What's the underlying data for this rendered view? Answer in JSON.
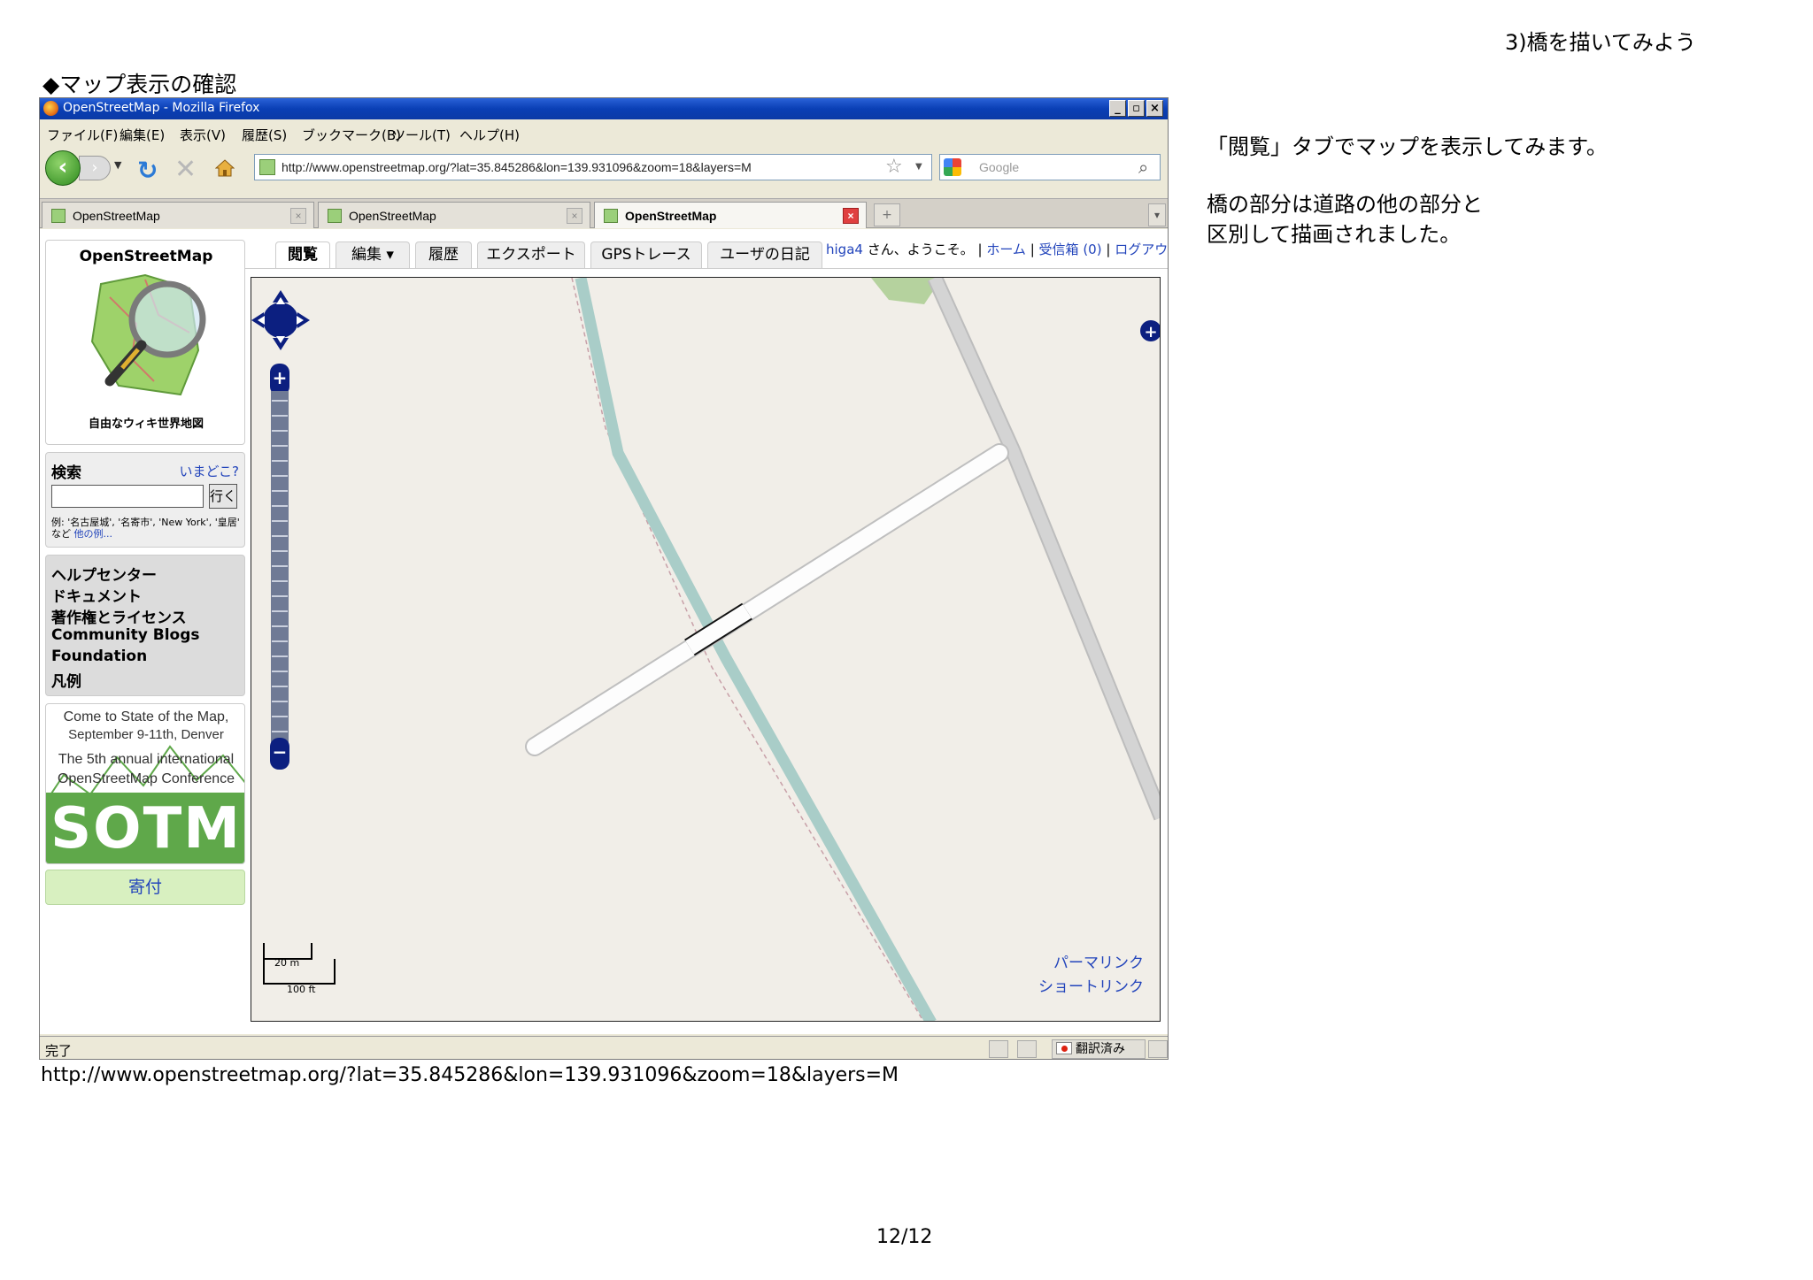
{
  "page": {
    "header": "3)橋を描いてみよう",
    "section_title": "◆マップ表示の確認",
    "description_1": "「閲覧」タブでマップを表示してみます。",
    "description_2_line1": "橋の部分は道路の他の部分と",
    "description_2_line2": "区別して描画されました。",
    "url_caption": "http://www.openstreetmap.org/?lat=35.845286&lon=139.931096&zoom=18&layers=M",
    "page_number": "12/12"
  },
  "window": {
    "title": "OpenStreetMap - Mozilla Firefox",
    "buttons": {
      "minimize": "_",
      "maximize": "▫",
      "close": "×"
    }
  },
  "menu": {
    "items": [
      "ファイル(F)",
      "編集(E)",
      "表示(V)",
      "履歴(S)",
      "ブックマーク(B)",
      "ツール(T)",
      "ヘルプ(H)"
    ]
  },
  "navbar": {
    "address": "http://www.openstreetmap.org/?lat=35.845286&lon=139.931096&zoom=18&layers=M",
    "search_placeholder": "Google",
    "icons": [
      "back-icon",
      "forward-icon",
      "reload-icon",
      "stop-icon",
      "home-icon",
      "star-icon",
      "search-icon"
    ]
  },
  "browser_tabs": [
    {
      "label": "OpenStreetMap",
      "active": false
    },
    {
      "label": "OpenStreetMap",
      "active": false
    },
    {
      "label": "OpenStreetMap",
      "active": true
    }
  ],
  "sidebar": {
    "logo_title": "OpenStreetMap",
    "logo_tagline": "自由なウィキ世界地図",
    "search": {
      "label": "検索",
      "where_link": "いまどこ?",
      "input_value": "",
      "go_button": "行く",
      "examples": "例: '名古屋城', '名寄市', 'New York', '皇居' など",
      "more_link": "他の例..."
    },
    "help_links": [
      "ヘルプセンター",
      "ドキュメント",
      "著作権とライセンス",
      "Community Blogs",
      "Foundation",
      "凡例"
    ],
    "sotm": {
      "line1": "Come to State of the Map,",
      "line2": "September 9-11th, Denver",
      "line3": "The 5th annual international",
      "line4": "OpenStreetMap Conference",
      "logo": "SOTM"
    },
    "donate": "寄付"
  },
  "osm_tabs": [
    "閲覧",
    "編集 ▾",
    "履歴",
    "エクスポート",
    "GPSトレース",
    "ユーザの日記"
  ],
  "user_bar": {
    "username": "higa4",
    "greeting": "さん、ようこそ。",
    "sep": "|",
    "home": "ホーム",
    "inbox": "受信箱 (0)",
    "logout": "ログアウト"
  },
  "map": {
    "permalink": "パーマリンク",
    "shortlink": "ショートリンク",
    "scale_metric": "20 m",
    "scale_imperial": "100 ft",
    "colors": {
      "background": "#f1eee8",
      "river": "#a9cdc8",
      "road": "#d0d0d0",
      "bridge": "#ffffff",
      "park": "#b5d29e"
    }
  },
  "statusbar": {
    "status": "完了",
    "translate": "翻訳済み"
  }
}
